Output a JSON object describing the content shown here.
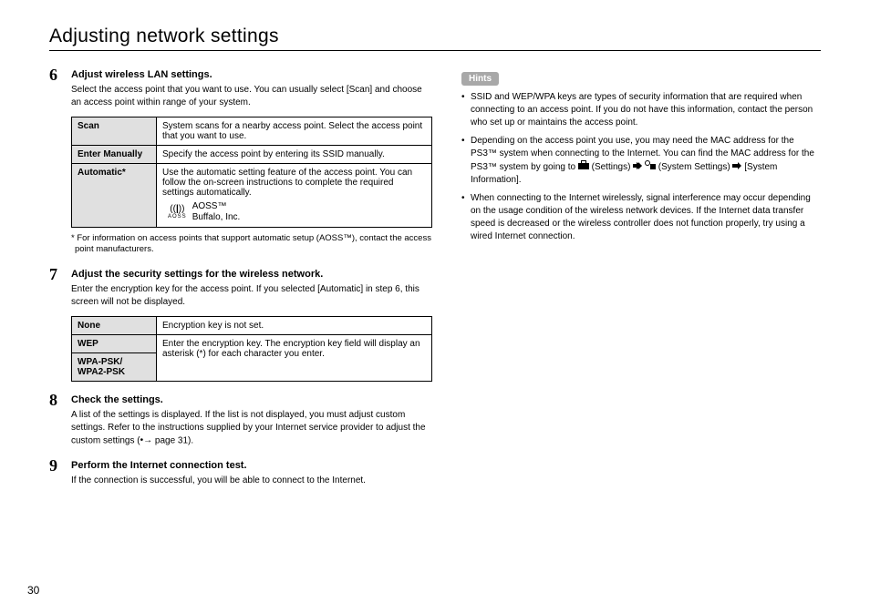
{
  "title": "Adjusting network settings",
  "page_number": "30",
  "page_ref": "page 31",
  "steps": {
    "s6": {
      "num": "6",
      "heading": "Adjust wireless LAN settings.",
      "text": "Select the access point that you want to use. You can usually select [Scan] and choose an access point within range of your system.",
      "rows": {
        "r0h": "Scan",
        "r0t": "System scans for a nearby access point. Select the access point that you want to use.",
        "r1h": "Enter Manually",
        "r1t": "Specify the access point by entering its SSID manually.",
        "r2h": "Automatic*",
        "r2t": "Use the automatic setting feature of the access point. You can follow the on-screen instructions to complete the required settings automatically.",
        "aoss_name": "AOSS™",
        "aoss_vendor": "Buffalo, Inc."
      },
      "footnote": "* For information on access points that support automatic setup (AOSS™), contact the access point manufacturers."
    },
    "s7": {
      "num": "7",
      "heading": "Adjust the security settings for the wireless network.",
      "text": "Enter the encryption key for the access point. If you selected [Automatic] in step 6, this screen will not be displayed.",
      "rows": {
        "r0h": "None",
        "r0t": "Encryption key is not set.",
        "r1h": "WEP",
        "r2h": "WPA-PSK/ WPA2-PSK",
        "mergedt": "Enter the encryption key. The encryption key field will display an asterisk (*) for each character you enter."
      }
    },
    "s8": {
      "num": "8",
      "heading": "Check the settings.",
      "text_a": "A list of the settings is displayed. If the list is not displayed, you must adjust custom settings. Refer to the instructions supplied by your Internet service provider to adjust the custom settings (",
      "text_b": ")."
    },
    "s9": {
      "num": "9",
      "heading": "Perform the Internet connection test.",
      "text": "If the connection is successful, you will be able to connect to the Internet."
    }
  },
  "hints": {
    "label": "Hints",
    "h0": "SSID and WEP/WPA keys are types of security information that are required when connecting to an access point. If you do not have this information, contact the person who set up or maintains the access point.",
    "h1a": "Depending on the access point you use, you may need the MAC address for the PS3™ system when connecting to the Internet. You can find the MAC address for the PS3™ system by going to ",
    "h1b": " (Settings) ",
    "h1c": " (System Settings) ",
    "h1d": " [System Information].",
    "h2": "When connecting to the Internet wirelessly, signal interference may occur depending on the usage condition of the wireless network devices. If the Internet data transfer speed is decreased or the wireless controller does not function properly, try using a wired Internet connection."
  }
}
